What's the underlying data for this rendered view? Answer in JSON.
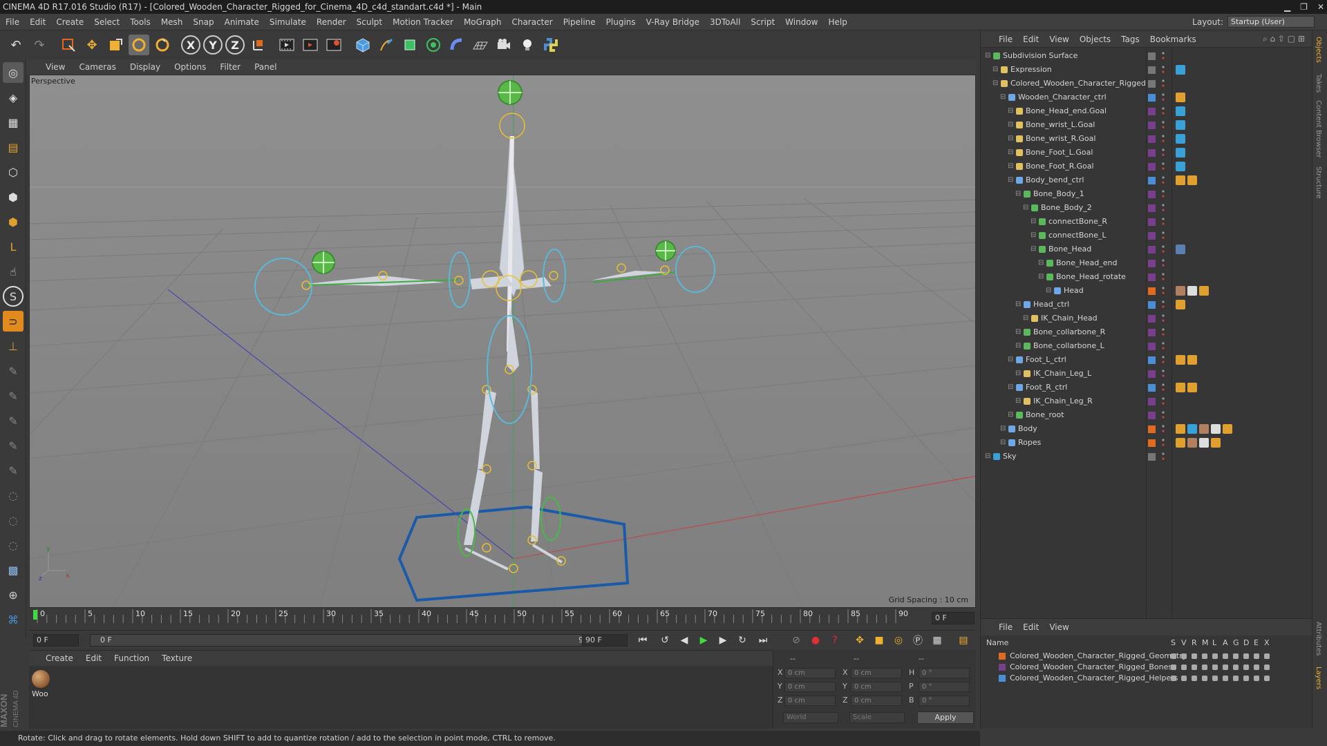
{
  "window": {
    "title": "CINEMA 4D R17.016 Studio (R17) - [Colored_Wooden_Character_Rigged_for_Cinema_4D_c4d_standart.c4d *] - Main"
  },
  "menu": [
    "File",
    "Edit",
    "Create",
    "Select",
    "Tools",
    "Mesh",
    "Snap",
    "Animate",
    "Simulate",
    "Render",
    "Sculpt",
    "Motion Tracker",
    "MoGraph",
    "Character",
    "Pipeline",
    "Plugins",
    "V-Ray Bridge",
    "3DToAll",
    "Script",
    "Window",
    "Help"
  ],
  "layout": {
    "label": "Layout:",
    "value": "Startup (User)"
  },
  "toolbar_axes": [
    "X",
    "Y",
    "Z"
  ],
  "viewport": {
    "menu": [
      "View",
      "Cameras",
      "Display",
      "Options",
      "Filter",
      "Panel"
    ],
    "name": "Perspective",
    "grid_spacing": "Grid Spacing : 10 cm"
  },
  "timeline": {
    "ticks": [
      "0",
      "5",
      "10",
      "15",
      "20",
      "25",
      "30",
      "35",
      "40",
      "45",
      "50",
      "55",
      "60",
      "65",
      "70",
      "75",
      "80",
      "85",
      "90"
    ],
    "current_frame_right": "0 F",
    "start_field": "0 F",
    "range_start": "0 F",
    "range_end": "90 F",
    "end_field": "90 F"
  },
  "material_manager": {
    "menu": [
      "Create",
      "Edit",
      "Function",
      "Texture"
    ],
    "materials": [
      {
        "name": "Woo"
      }
    ]
  },
  "coordinates": {
    "headers": [
      "--",
      "--",
      "--"
    ],
    "rows": [
      {
        "a": "X",
        "av": "0 cm",
        "b": "X",
        "bv": "0 cm",
        "c": "H",
        "cv": "0 °"
      },
      {
        "a": "Y",
        "av": "0 cm",
        "b": "Y",
        "bv": "0 cm",
        "c": "P",
        "cv": "0 °"
      },
      {
        "a": "Z",
        "av": "0 cm",
        "b": "Z",
        "bv": "0 cm",
        "c": "B",
        "cv": "0 °"
      }
    ],
    "mode1": "World",
    "mode2": "Scale",
    "apply": "Apply"
  },
  "status": "Rotate: Click and drag to rotate elements. Hold down SHIFT to add to quantize rotation / add to the selection in point mode, CTRL to remove.",
  "object_manager": {
    "menu": [
      "File",
      "Edit",
      "View",
      "Objects",
      "Tags",
      "Bookmarks"
    ],
    "objects": [
      {
        "name": "Subdivision Surface",
        "depth": 0,
        "icon": "#5cb85c",
        "layer": "#777777",
        "tags": []
      },
      {
        "name": "Expression",
        "depth": 1,
        "icon": "#e0c060",
        "layer": "#777777",
        "tags": [
          "#3aa0d8"
        ]
      },
      {
        "name": "Colored_Wooden_Character_Rigged",
        "depth": 1,
        "icon": "#e0c060",
        "layer": "#777777",
        "tags": []
      },
      {
        "name": "Wooden_Character_ctrl",
        "depth": 2,
        "icon": "#6fa8e8",
        "layer": "#4a8fd6",
        "tags": [
          "#e0a030"
        ]
      },
      {
        "name": "Bone_Head_end.Goal",
        "depth": 3,
        "icon": "#e0c060",
        "layer": "#7a3f8c",
        "tags": [
          "#3aa0d8"
        ]
      },
      {
        "name": "Bone_wrist_L.Goal",
        "depth": 3,
        "icon": "#e0c060",
        "layer": "#7a3f8c",
        "tags": [
          "#3aa0d8"
        ]
      },
      {
        "name": "Bone_wrist_R.Goal",
        "depth": 3,
        "icon": "#e0c060",
        "layer": "#7a3f8c",
        "tags": [
          "#3aa0d8"
        ]
      },
      {
        "name": "Bone_Foot_L.Goal",
        "depth": 3,
        "icon": "#e0c060",
        "layer": "#7a3f8c",
        "tags": [
          "#3aa0d8"
        ]
      },
      {
        "name": "Bone_Foot_R.Goal",
        "depth": 3,
        "icon": "#e0c060",
        "layer": "#7a3f8c",
        "tags": [
          "#3aa0d8"
        ]
      },
      {
        "name": "Body_bend_ctrl",
        "depth": 3,
        "icon": "#6fa8e8",
        "layer": "#4a8fd6",
        "tags": [
          "#e0a030",
          "#e0a030"
        ]
      },
      {
        "name": "Bone_Body_1",
        "depth": 4,
        "icon": "#5cb85c",
        "layer": "#7a3f8c",
        "tags": []
      },
      {
        "name": "Bone_Body_2",
        "depth": 5,
        "icon": "#5cb85c",
        "layer": "#7a3f8c",
        "tags": []
      },
      {
        "name": "connectBone_R",
        "depth": 6,
        "icon": "#5cb85c",
        "layer": "#7a3f8c",
        "tags": []
      },
      {
        "name": "connectBone_L",
        "depth": 6,
        "icon": "#5cb85c",
        "layer": "#7a3f8c",
        "tags": []
      },
      {
        "name": "Bone_Head",
        "depth": 6,
        "icon": "#5cb85c",
        "layer": "#7a3f8c",
        "tags": [
          "#5a7fb0"
        ]
      },
      {
        "name": "Bone_Head_end",
        "depth": 7,
        "icon": "#5cb85c",
        "layer": "#7a3f8c",
        "tags": []
      },
      {
        "name": "Bone_Head_rotate",
        "depth": 7,
        "icon": "#5cb85c",
        "layer": "#7a3f8c",
        "tags": []
      },
      {
        "name": "Head",
        "depth": 8,
        "icon": "#6fa8e8",
        "layer": "#e06a20",
        "tags": [
          "#b08060",
          "#dddddd",
          "#e0a030"
        ]
      },
      {
        "name": "Head_ctrl",
        "depth": 4,
        "icon": "#6fa8e8",
        "layer": "#4a8fd6",
        "tags": [
          "#e0a030"
        ]
      },
      {
        "name": "IK_Chain_Head",
        "depth": 5,
        "icon": "#e0c060",
        "layer": "#7a3f8c",
        "tags": []
      },
      {
        "name": "Bone_collarbone_R",
        "depth": 4,
        "icon": "#5cb85c",
        "layer": "#7a3f8c",
        "tags": []
      },
      {
        "name": "Bone_collarbone_L",
        "depth": 4,
        "icon": "#5cb85c",
        "layer": "#7a3f8c",
        "tags": []
      },
      {
        "name": "Foot_L_ctrl",
        "depth": 3,
        "icon": "#6fa8e8",
        "layer": "#4a8fd6",
        "tags": [
          "#e0a030",
          "#e0a030"
        ]
      },
      {
        "name": "IK_Chain_Leg_L",
        "depth": 4,
        "icon": "#e0c060",
        "layer": "#7a3f8c",
        "tags": []
      },
      {
        "name": "Foot_R_ctrl",
        "depth": 3,
        "icon": "#6fa8e8",
        "layer": "#4a8fd6",
        "tags": [
          "#e0a030",
          "#e0a030"
        ]
      },
      {
        "name": "IK_Chain_Leg_R",
        "depth": 4,
        "icon": "#e0c060",
        "layer": "#7a3f8c",
        "tags": []
      },
      {
        "name": "Bone_root",
        "depth": 3,
        "icon": "#5cb85c",
        "layer": "#7a3f8c",
        "tags": []
      },
      {
        "name": "Body",
        "depth": 2,
        "icon": "#6fa8e8",
        "layer": "#e06a20",
        "tags": [
          "#e0a030",
          "#3aa0d8",
          "#b08060",
          "#dddddd",
          "#e0a030"
        ]
      },
      {
        "name": "Ropes",
        "depth": 2,
        "icon": "#6fa8e8",
        "layer": "#e06a20",
        "tags": [
          "#e0a030",
          "#b08060",
          "#dddddd",
          "#e0a030"
        ]
      },
      {
        "name": "Sky",
        "depth": 0,
        "icon": "#3aa0d8",
        "layer": "#777777",
        "tags": []
      }
    ]
  },
  "layer_manager": {
    "menu": [
      "File",
      "Edit",
      "View"
    ],
    "columns": [
      "Name",
      "S",
      "V",
      "R",
      "M",
      "L",
      "A",
      "G",
      "D",
      "E",
      "X"
    ],
    "layers": [
      {
        "name": "Colored_Wooden_Character_Rigged_Geometry",
        "color": "#e06a20"
      },
      {
        "name": "Colored_Wooden_Character_Rigged_Bones",
        "color": "#7a3f8c"
      },
      {
        "name": "Colored_Wooden_Character_Rigged_Helpers",
        "color": "#4a8fd6"
      }
    ]
  },
  "side_tabs": [
    "Objects",
    "Takes",
    "Content Browser",
    "Structure"
  ],
  "side_tabs_bottom": [
    "Attributes",
    "Layers"
  ]
}
